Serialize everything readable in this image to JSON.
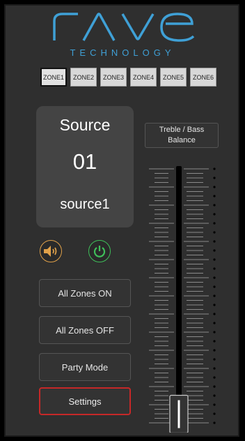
{
  "brand": {
    "logo_text": "rave",
    "tagline": "TECHNOLOGY",
    "accent": "#3fa0d6"
  },
  "zones": [
    {
      "label": "ZONE1",
      "active": true
    },
    {
      "label": "ZONE2",
      "active": false
    },
    {
      "label": "ZONE3",
      "active": false
    },
    {
      "label": "ZONE4",
      "active": false
    },
    {
      "label": "ZONE5",
      "active": false
    },
    {
      "label": "ZONE6",
      "active": false
    }
  ],
  "source": {
    "title": "Source",
    "number": "01",
    "name": "source1"
  },
  "controls": {
    "mute_icon": "speaker-icon",
    "mute_color": "#e0a14a",
    "power_icon": "power-icon",
    "power_color": "#3fbf5a"
  },
  "buttons": {
    "all_on": "All Zones ON",
    "all_off": "All Zones OFF",
    "party": "Party Mode",
    "settings": "Settings",
    "settings_border": "#c62828"
  },
  "treble_bass": {
    "line1": "Treble / Bass",
    "line2": "Balance"
  },
  "volume": {
    "level": 0.05
  }
}
